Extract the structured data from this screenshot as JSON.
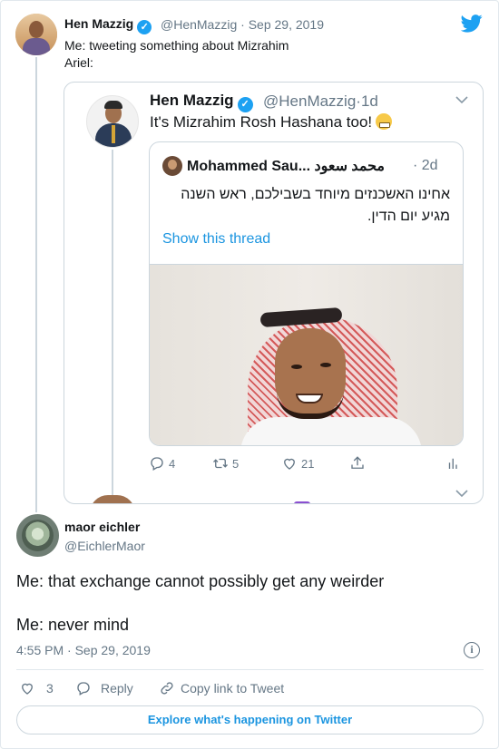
{
  "tweet": {
    "author_name": "Hen Mazzig",
    "author_handle": "@HenMazzig",
    "separator": "·",
    "date": "Sep 29, 2019",
    "line1": "Me: tweeting something about Mizrahim",
    "line2": "Ariel:",
    "embedded": {
      "author_name": "Hen Mazzig",
      "author_handle": "@HenMazzig",
      "age": "1d",
      "text": "It's Mizrahim Rosh Hashana too!",
      "quoted": {
        "author_name": "Mohammed Sau... محمد سعود",
        "age": "· 2d",
        "text_line1": "אחינו האשכנזים מיוחד בשבילכם, ראש השנה",
        "text_line2": "מגיע יום הדין.",
        "show_thread": "Show this thread"
      },
      "actions": {
        "replies": "4",
        "retweets": "5",
        "likes": "21"
      }
    }
  },
  "reply": {
    "author_name": "maor eichler",
    "author_handle": "@EichlerMaor",
    "line1": "Me: that exchange cannot possibly get any weirder",
    "line2": "Me: never mind",
    "timestamp": "4:55 PM · Sep 29, 2019",
    "likes": "3",
    "reply_label": "Reply",
    "copy_link_label": "Copy link to Tweet",
    "explore_label": "Explore what's happening on Twitter"
  },
  "colors": {
    "accent": "#1da1f2",
    "link": "#1b95e0",
    "muted": "#657786",
    "border": "#e1e8ed"
  },
  "icons": [
    "twitter-bird-icon",
    "verified-badge-icon",
    "chevron-down-icon",
    "reply-icon",
    "retweet-icon",
    "heart-icon",
    "share-icon",
    "analytics-icon",
    "info-icon",
    "link-icon",
    "grimacing-emoji-icon"
  ]
}
